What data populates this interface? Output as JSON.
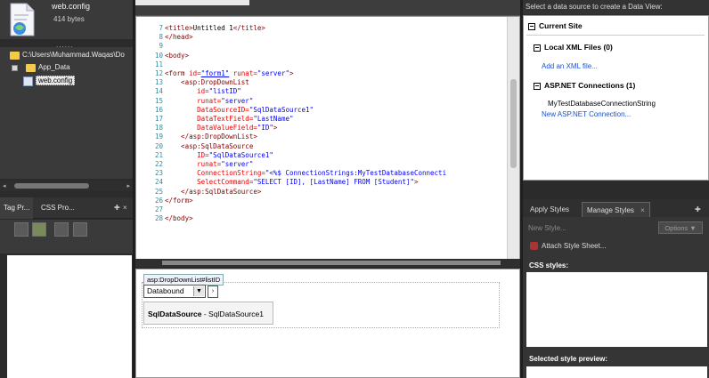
{
  "solution_explorer": {
    "file_name": "web.config",
    "file_size": "414 bytes",
    "dots": "......",
    "tree": [
      {
        "label": "C:\\Users\\Muhammad.Waqas\\Do",
        "type": "folder"
      },
      {
        "label": "App_Data",
        "type": "folder"
      },
      {
        "label": "web.config",
        "type": "file",
        "selected": true
      }
    ]
  },
  "tag_panel": {
    "tabs": [
      "Tag Pr...",
      "CSS Pro..."
    ],
    "pin": "✚",
    "close": "×"
  },
  "editor": {
    "lines": [
      {
        "n": "7",
        "segments": [
          {
            "c": "tag",
            "t": "<title>"
          },
          {
            "c": "txt",
            "t": "Untitled 1"
          },
          {
            "c": "tag",
            "t": "</title>"
          }
        ]
      },
      {
        "n": "8",
        "segments": [
          {
            "c": "tag",
            "t": "</head>"
          }
        ]
      },
      {
        "n": "9",
        "segments": []
      },
      {
        "n": "10",
        "segments": [
          {
            "c": "tag",
            "t": "<body>"
          }
        ]
      },
      {
        "n": "11",
        "segments": []
      },
      {
        "n": "12",
        "segments": [
          {
            "c": "tag",
            "t": "<form "
          },
          {
            "c": "att",
            "t": "id="
          },
          {
            "c": "val",
            "t": "\"form1\""
          },
          {
            "c": "att",
            "t": " runat="
          },
          {
            "c": "val",
            "t": "\"server\""
          },
          {
            "c": "tag",
            "t": ">"
          }
        ]
      },
      {
        "n": "13",
        "segments": [
          {
            "c": "tag",
            "t": "    <asp:DropDownList"
          }
        ]
      },
      {
        "n": "14",
        "segments": [
          {
            "c": "att",
            "t": "        id="
          },
          {
            "c": "val",
            "t": "\"listID\""
          }
        ]
      },
      {
        "n": "15",
        "segments": [
          {
            "c": "att",
            "t": "        runat="
          },
          {
            "c": "val",
            "t": "\"server\""
          }
        ]
      },
      {
        "n": "16",
        "segments": [
          {
            "c": "att",
            "t": "        DataSourceID="
          },
          {
            "c": "val",
            "t": "\"SqlDataSource1\""
          }
        ]
      },
      {
        "n": "17",
        "segments": [
          {
            "c": "att",
            "t": "        DataTextField="
          },
          {
            "c": "val",
            "t": "\"LastName\""
          }
        ]
      },
      {
        "n": "18",
        "segments": [
          {
            "c": "att",
            "t": "        DataValueField="
          },
          {
            "c": "val",
            "t": "\"ID\""
          },
          {
            "c": "tag",
            "t": ">"
          }
        ]
      },
      {
        "n": "19",
        "segments": [
          {
            "c": "tag",
            "t": "    </asp:DropDownList>"
          }
        ]
      },
      {
        "n": "20",
        "segments": [
          {
            "c": "tag",
            "t": "    <asp:SqlDataSource"
          }
        ]
      },
      {
        "n": "21",
        "segments": [
          {
            "c": "att",
            "t": "        ID="
          },
          {
            "c": "val",
            "t": "\"SqlDataSource1\""
          }
        ]
      },
      {
        "n": "22",
        "segments": [
          {
            "c": "att",
            "t": "        runat="
          },
          {
            "c": "val",
            "t": "\"server\""
          }
        ]
      },
      {
        "n": "23",
        "segments": [
          {
            "c": "att",
            "t": "        ConnectionString="
          },
          {
            "c": "val",
            "t": "\"<%$ ConnectionStrings:MyTestDatabaseConnecti"
          }
        ]
      },
      {
        "n": "24",
        "segments": [
          {
            "c": "att",
            "t": "        SelectCommand="
          },
          {
            "c": "val",
            "t": "\"SELECT [ID], [LastName] FROM [Student]\""
          },
          {
            "c": "tag",
            "t": ">"
          }
        ]
      },
      {
        "n": "25",
        "segments": [
          {
            "c": "tag",
            "t": "    </asp:SqlDataSource>"
          }
        ]
      },
      {
        "n": "26",
        "segments": [
          {
            "c": "tag",
            "t": "</form>"
          }
        ]
      },
      {
        "n": "27",
        "segments": []
      },
      {
        "n": "28",
        "segments": [
          {
            "c": "tag",
            "t": "</body>"
          }
        ]
      }
    ]
  },
  "design": {
    "control_label": "asp:DropDownList#listID",
    "dropdown_value": "Databound",
    "dropdown_arrow": "▼",
    "smart_tag": "›",
    "sqlds_name": "SqlDataSource",
    "sqlds_id": " - SqlDataSource1"
  },
  "data_source": {
    "header": "Select a data source to create a Data View:",
    "current_site": "Current Site",
    "local_xml": "Local XML Files (0)",
    "add_xml": "Add an XML file...",
    "aspnet_connections": "ASP.NET Connections (1)",
    "connection_name": "MyTestDatabaseConnectionString",
    "new_connection": "New ASP.NET Connection..."
  },
  "styles": {
    "tabs": [
      "Apply Styles",
      "Manage Styles"
    ],
    "tab_close": "×",
    "pin": "✚",
    "new_style": "New Style...",
    "options": "Options ▼",
    "attach": "Attach Style Sheet...",
    "css_styles_label": "CSS styles:",
    "preview_label": "Selected style preview:"
  }
}
